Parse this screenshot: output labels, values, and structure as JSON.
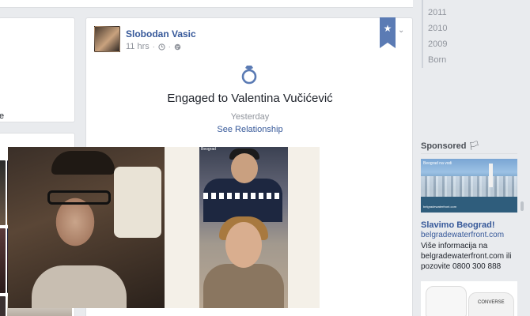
{
  "left": {
    "clip_text": "e"
  },
  "post": {
    "author": "Slobodan Vasic",
    "time": "11 hrs",
    "bookmark_glyph": "★",
    "chevron_glyph": "⌄",
    "event_title": "Engaged to Valentina Vučićević",
    "event_date": "Yesterday",
    "see_relationship": "See Relationship",
    "message": "❤",
    "photo_sign": "Beograd"
  },
  "timeline": {
    "years": [
      "2011",
      "2010",
      "2009",
      "Born"
    ]
  },
  "sponsored": {
    "label": "Sponsored",
    "flag_glyph": "🏳",
    "ad_title": "Slavimo Beograd!",
    "ad_url": "belgradewaterfront.com",
    "ad_body": "Više informacija na belgradewaterfront.com ili pozovite 0800 300 888",
    "ad_logo_text": "Beograd na vodi",
    "ad_caption": "belgradewaterfront.com",
    "second_ad_brand": "CONVERSE"
  },
  "colors": {
    "link": "#365899",
    "bookmark": "#5b7bb4",
    "page_bg": "#e9ebee"
  },
  "icons": {
    "ring": "ring-icon",
    "clock": "clock-icon",
    "globe": "globe-icon",
    "bookmark": "star-icon",
    "chevron": "chevron-down-icon",
    "flag": "flag-icon"
  }
}
